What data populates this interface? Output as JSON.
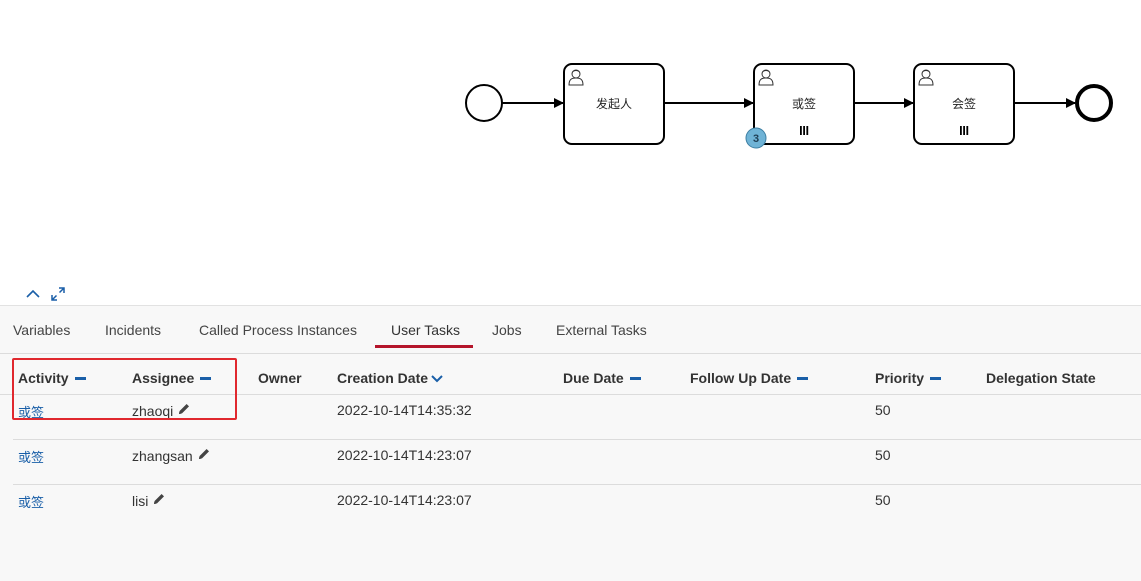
{
  "diagram": {
    "tasks": [
      {
        "label": "发起人"
      },
      {
        "label": "或签",
        "badge": "3"
      },
      {
        "label": "会签"
      }
    ]
  },
  "controls": {
    "collapse_icon": "chevron-up-icon",
    "fullscreen_icon": "expand-icon"
  },
  "tabs": [
    {
      "label": "Variables"
    },
    {
      "label": "Incidents"
    },
    {
      "label": "Called Process Instances"
    },
    {
      "label": "User Tasks",
      "active": true
    },
    {
      "label": "Jobs"
    },
    {
      "label": "External Tasks"
    }
  ],
  "table": {
    "columns": [
      "Activity",
      "Assignee",
      "Owner",
      "Creation Date",
      "Due Date",
      "Follow Up Date",
      "Priority",
      "Delegation State"
    ],
    "rows": [
      {
        "activity": "或签",
        "assignee": "zhaoqi",
        "owner": "",
        "creation_date": "2022-10-14T14:35:32",
        "due_date": "",
        "follow_up_date": "",
        "priority": "50",
        "delegation_state": ""
      },
      {
        "activity": "或签",
        "assignee": "zhangsan",
        "owner": "",
        "creation_date": "2022-10-14T14:23:07",
        "due_date": "",
        "follow_up_date": "",
        "priority": "50",
        "delegation_state": ""
      },
      {
        "activity": "或签",
        "assignee": "lisi",
        "owner": "",
        "creation_date": "2022-10-14T14:23:07",
        "due_date": "",
        "follow_up_date": "",
        "priority": "50",
        "delegation_state": ""
      }
    ]
  },
  "colors": {
    "link": "#1a5fa8",
    "active_tab": "#b5152b",
    "highlight": "#e0282e",
    "badge": "#6fb3d6"
  }
}
